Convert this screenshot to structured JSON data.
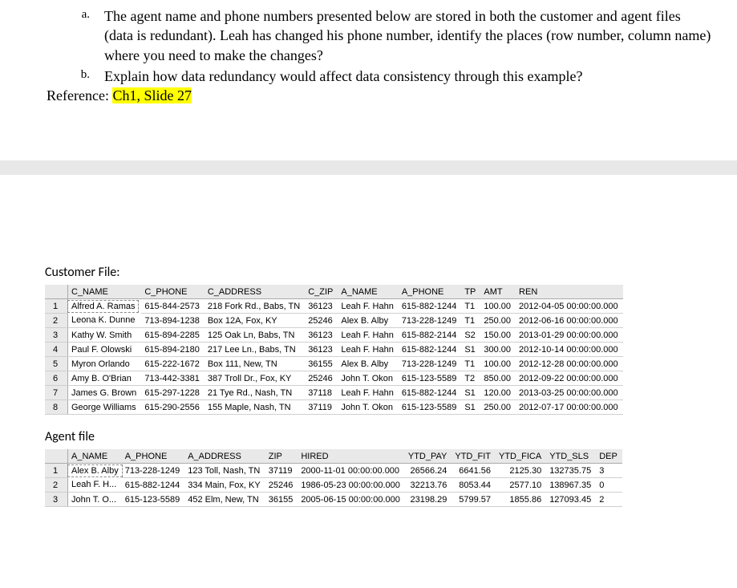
{
  "questions": {
    "a_mark": "a.",
    "a_text": "The agent name and phone numbers presented below are stored in both the customer and agent files (data is redundant). Leah has changed his phone number, identify the places (row number, column name) where you need to make the changes?",
    "b_mark": "b.",
    "b_text": "Explain how data redundancy would affect data consistency through this example?"
  },
  "reference": {
    "label": "Reference: ",
    "value": "Ch1, Slide 27"
  },
  "customer_header": "Customer File:",
  "agent_header": "Agent file",
  "customer_cols": [
    "C_NAME",
    "C_PHONE",
    "C_ADDRESS",
    "C_ZIP",
    "A_NAME",
    "A_PHONE",
    "TP",
    "AMT",
    "REN"
  ],
  "customer_rows": [
    {
      "n": "1",
      "c": [
        "Alfred A. Ramas",
        "615-844-2573",
        "218 Fork Rd., Babs, TN",
        "36123",
        "Leah F. Hahn",
        "615-882-1244",
        "T1",
        "100.00",
        "2012-04-05 00:00:00.000"
      ]
    },
    {
      "n": "2",
      "c": [
        "Leona K. Dunne",
        "713-894-1238",
        "Box 12A, Fox, KY",
        "25246",
        "Alex B. Alby",
        "713-228-1249",
        "T1",
        "250.00",
        "2012-06-16 00:00:00.000"
      ]
    },
    {
      "n": "3",
      "c": [
        "Kathy W. Smith",
        "615-894-2285",
        "125 Oak Ln, Babs, TN",
        "36123",
        "Leah F. Hahn",
        "615-882-2144",
        "S2",
        "150.00",
        "2013-01-29 00:00:00.000"
      ]
    },
    {
      "n": "4",
      "c": [
        "Paul F. Olowski",
        "615-894-2180",
        "217 Lee Ln., Babs, TN",
        "36123",
        "Leah F. Hahn",
        "615-882-1244",
        "S1",
        "300.00",
        "2012-10-14 00:00:00.000"
      ]
    },
    {
      "n": "5",
      "c": [
        "Myron Orlando",
        "615-222-1672",
        "Box 111, New, TN",
        "36155",
        "Alex B. Alby",
        "713-228-1249",
        "T1",
        "100.00",
        "2012-12-28 00:00:00.000"
      ]
    },
    {
      "n": "6",
      "c": [
        "Amy B. O'Brian",
        "713-442-3381",
        "387 Troll Dr., Fox, KY",
        "25246",
        "John T. Okon",
        "615-123-5589",
        "T2",
        "850.00",
        "2012-09-22 00:00:00.000"
      ]
    },
    {
      "n": "7",
      "c": [
        "James G. Brown",
        "615-297-1228",
        "21 Tye Rd., Nash, TN",
        "37118",
        "Leah F. Hahn",
        "615-882-1244",
        "S1",
        "120.00",
        "2013-03-25 00:00:00.000"
      ]
    },
    {
      "n": "8",
      "c": [
        "George Williams",
        "615-290-2556",
        "155 Maple, Nash, TN",
        "37119",
        "John T. Okon",
        "615-123-5589",
        "S1",
        "250.00",
        "2012-07-17 00:00:00.000"
      ]
    }
  ],
  "agent_cols": [
    "A_NAME",
    "A_PHONE",
    "A_ADDRESS",
    "ZIP",
    "HIRED",
    "YTD_PAY",
    "YTD_FIT",
    "YTD_FICA",
    "YTD_SLS",
    "DEP"
  ],
  "agent_rows": [
    {
      "n": "1",
      "c": [
        "Alex B. Alby",
        "713-228-1249",
        "123 Toll, Nash, TN",
        "37119",
        "2000-11-01 00:00:00.000",
        "26566.24",
        "6641.56",
        "2125.30",
        "132735.75",
        "3"
      ]
    },
    {
      "n": "2",
      "c": [
        "Leah F. H...",
        "615-882-1244",
        "334 Main, Fox, KY",
        "25246",
        "1986-05-23 00:00:00.000",
        "32213.76",
        "8053.44",
        "2577.10",
        "138967.35",
        "0"
      ]
    },
    {
      "n": "3",
      "c": [
        "John T. O...",
        "615-123-5589",
        "452 Elm, New, TN",
        "36155",
        "2005-06-15 00:00:00.000",
        "23198.29",
        "5799.57",
        "1855.86",
        "127093.45",
        "2"
      ]
    }
  ]
}
